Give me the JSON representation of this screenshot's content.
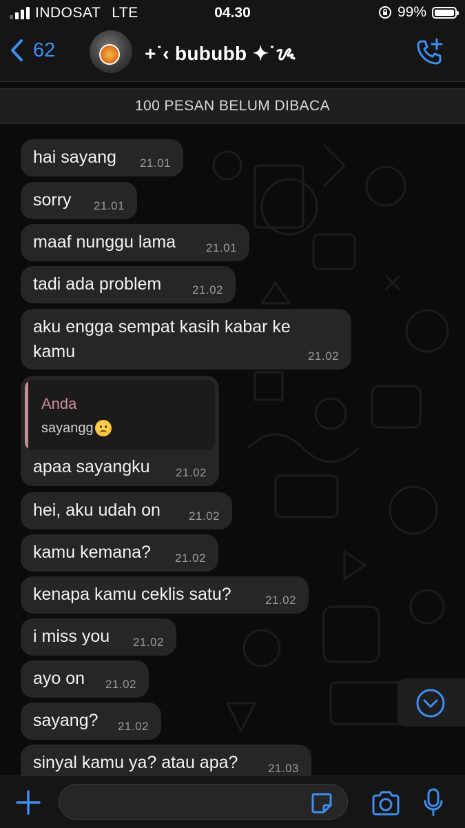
{
  "status": {
    "carrier": "INDOSAT",
    "network": "LTE",
    "time": "04.30",
    "battery": "99%",
    "battery_level": 0.99
  },
  "header": {
    "back_count": "62",
    "contact_name": "+˙‹ bububb ✦˙ᝰ"
  },
  "banner": {
    "unread": "100 PESAN BELUM DIBACA"
  },
  "messages": [
    {
      "text": "hai sayang",
      "time": "21.01"
    },
    {
      "text": "sorry",
      "time": "21.01"
    },
    {
      "text": "maaf nunggu lama",
      "time": "21.01"
    },
    {
      "text": "tadi ada problem",
      "time": "21.02"
    },
    {
      "text": "aku engga sempat kasih kabar ke kamu",
      "time": "21.02"
    },
    {
      "text": "apaa sayangku",
      "time": "21.02",
      "reply": {
        "author": "Anda",
        "text": "sayangg",
        "emoji": "worried-face"
      }
    },
    {
      "text": "hei, aku udah on",
      "time": "21.02"
    },
    {
      "text": "kamu kemana?",
      "time": "21.02"
    },
    {
      "text": "kenapa kamu ceklis satu?",
      "time": "21.02"
    },
    {
      "text": "i miss you",
      "time": "21.02"
    },
    {
      "text": "ayo on",
      "time": "21.02"
    },
    {
      "text": "sayang?",
      "time": "21.02"
    },
    {
      "text": "sinyal kamu ya? atau apa?",
      "time": "21.03"
    }
  ],
  "icons": {
    "back": "chevron-left-icon",
    "call": "phone-plus-icon",
    "scroll": "chevron-down-circle-icon",
    "attach": "plus-icon",
    "sticker": "sticker-icon",
    "camera": "camera-icon",
    "mic": "microphone-icon"
  },
  "colors": {
    "accent": "#3e8ff0",
    "bubble": "#262626",
    "reply_author": "#c98d99"
  }
}
